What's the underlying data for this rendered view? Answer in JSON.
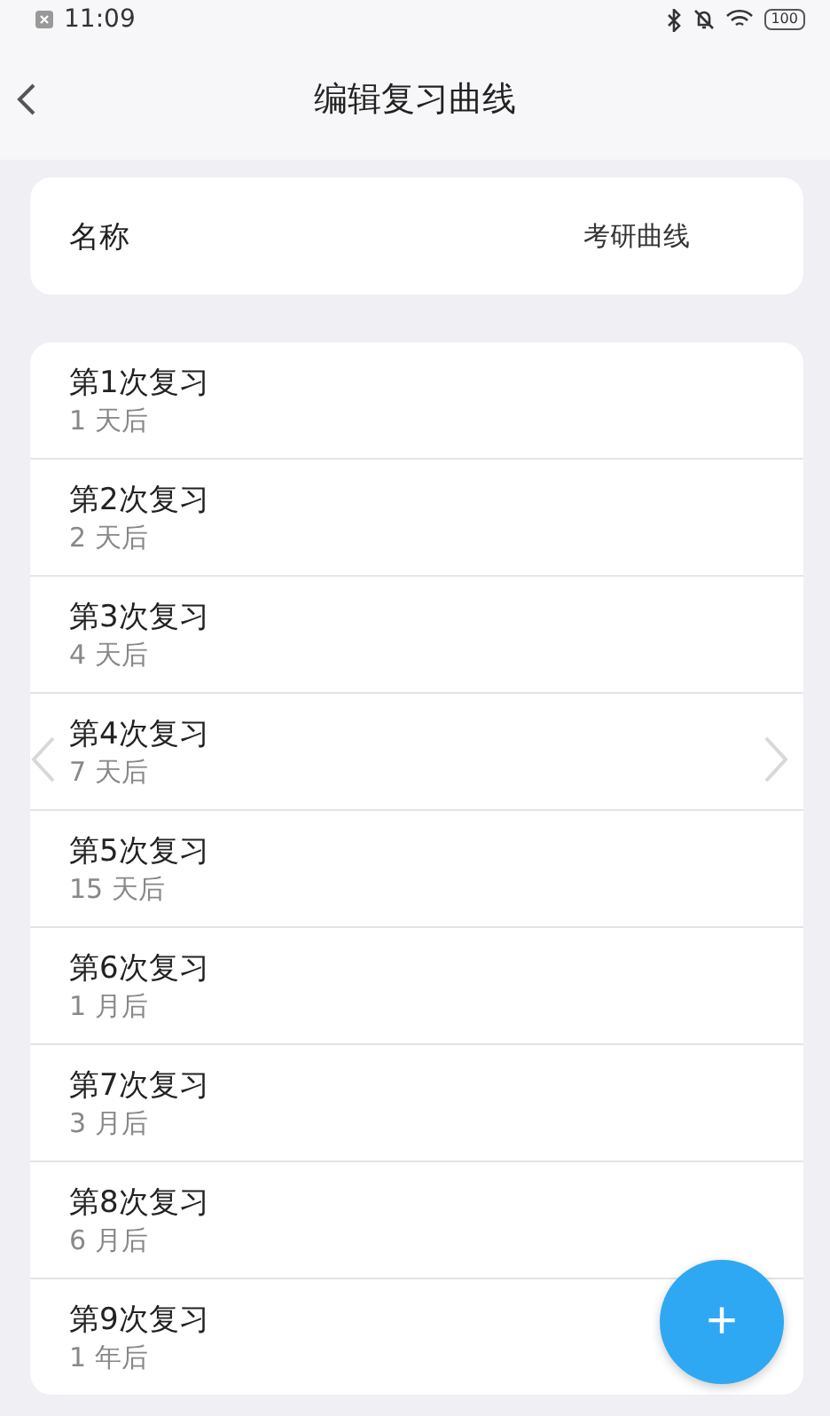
{
  "status_bar": {
    "time": "11:09",
    "battery": "100"
  },
  "header": {
    "title": "编辑复习曲线"
  },
  "name_field": {
    "label": "名称",
    "value": "考研曲线"
  },
  "reviews": [
    {
      "title": "第1次复习",
      "interval": "1 天后"
    },
    {
      "title": "第2次复习",
      "interval": "2 天后"
    },
    {
      "title": "第3次复习",
      "interval": "4 天后"
    },
    {
      "title": "第4次复习",
      "interval": "7 天后"
    },
    {
      "title": "第5次复习",
      "interval": "15 天后"
    },
    {
      "title": "第6次复习",
      "interval": "1 月后"
    },
    {
      "title": "第7次复习",
      "interval": "3 月后"
    },
    {
      "title": "第8次复习",
      "interval": "6 月后"
    },
    {
      "title": "第9次复习",
      "interval": "1 年后"
    }
  ],
  "add_button": {
    "label": "+"
  }
}
